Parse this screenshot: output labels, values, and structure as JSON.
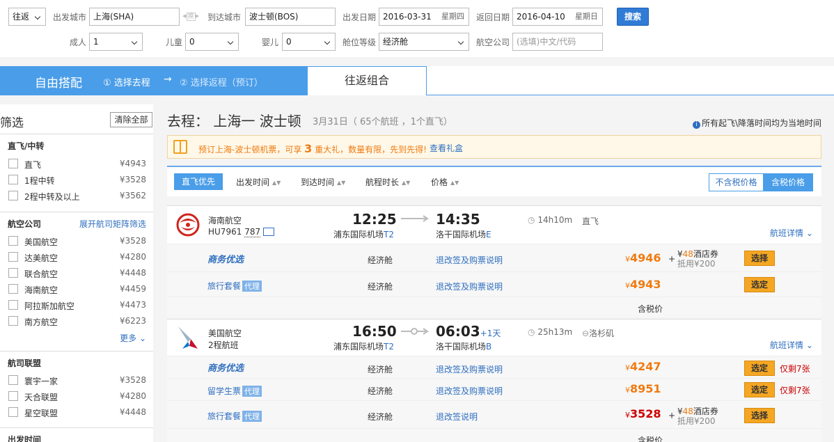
{
  "search": {
    "trip_type": "往返",
    "from_label": "出发城市",
    "from_value": "上海(SHA)",
    "swap_label": "换",
    "to_label": "到达城市",
    "to_value": "波士顿(BOS)",
    "depart_label": "出发日期",
    "depart_value": "2016-03-31",
    "depart_weekday": "星期四",
    "return_label": "返回日期",
    "return_value": "2016-04-10",
    "return_weekday": "星期日",
    "search_button": "搜索",
    "adult_label": "成人",
    "adult_value": "1",
    "child_label": "儿童",
    "child_value": "0",
    "infant_label": "婴儿",
    "infant_value": "0",
    "cabin_label": "舱位等级",
    "cabin_value": "经济舱",
    "airline_label": "航空公司",
    "airline_placeholder": "(选填)中文/代码"
  },
  "tabs": {
    "title": "自由搭配",
    "step1": "① 选择去程",
    "arrow": "→",
    "step2": "② 选择返程（预订）",
    "combo": "往返组合"
  },
  "filters": {
    "title": "筛选",
    "clear_all": "清除全部",
    "groups": {
      "stops": {
        "title": "直飞/中转",
        "items": [
          {
            "name": "直飞",
            "price": "¥4943"
          },
          {
            "name": "1程中转",
            "price": "¥3528"
          },
          {
            "name": "2程中转及以上",
            "price": "¥3562"
          }
        ]
      },
      "airlines": {
        "title": "航空公司",
        "link": "展开航司矩阵筛选",
        "items": [
          {
            "name": "美国航空",
            "price": "¥3528"
          },
          {
            "name": "达美航空",
            "price": "¥4280"
          },
          {
            "name": "联合航空",
            "price": "¥4448"
          },
          {
            "name": "海南航空",
            "price": "¥4459"
          },
          {
            "name": "阿拉斯加航空",
            "price": "¥4473"
          },
          {
            "name": "南方航空",
            "price": "¥6223"
          }
        ],
        "more": "更多"
      },
      "alliances": {
        "title": "航司联盟",
        "items": [
          {
            "name": "寰宇一家",
            "price": "¥3528"
          },
          {
            "name": "天合联盟",
            "price": "¥4280"
          },
          {
            "name": "星空联盟",
            "price": "¥4448"
          }
        ]
      },
      "depart_time": {
        "title": "出发时间"
      }
    }
  },
  "results": {
    "route": "去程： 上海一 波士顿",
    "meta": "3月31日（ 65个航班 ，1个直飞）",
    "note": "所有起飞\\降落时间均为当地时间",
    "promo_text_a": "预订上海-波士顿机票，可享",
    "promo_num": "3",
    "promo_text_b": "重大礼，数量有限，先到先得!",
    "promo_link": "查看礼盒",
    "sort": {
      "direct_first": "直飞优先",
      "depart_time": "出发时间",
      "arrive_time": "到达时间",
      "duration": "航程时长",
      "price": "价格",
      "excl_tax": "不含税价格",
      "incl_tax": "含税价格"
    },
    "tax_label": "含税价",
    "flights": [
      {
        "airline": "海南航空",
        "flight_no": "HU7961",
        "aircraft": "787",
        "dep_time": "12:25",
        "dep_airport": "浦东国际机场",
        "dep_terminal": "T2",
        "arr_time": "14:35",
        "arr_plus": "",
        "arr_airport": "洛干国际机场",
        "arr_terminal": "E",
        "duration": "14h10m",
        "type": "直飞",
        "detail": "航班详情",
        "fares": [
          {
            "product": "商务优选",
            "cabin": "经济舱",
            "rule": "退改签及购票说明",
            "price": "4946",
            "coupon_amt": "48",
            "coupon_txt": "酒店券",
            "coupon_sub": "抵用¥200",
            "button": "选择",
            "left": ""
          },
          {
            "product": "旅行套餐",
            "product_tag": "代理",
            "cabin": "经济舱",
            "rule": "退改签及购票说明",
            "price": "4943",
            "button": "选定",
            "left": ""
          }
        ]
      },
      {
        "airline": "美国航空",
        "flight_no": "2程航班",
        "dep_time": "16:50",
        "dep_airport": "浦东国际机场",
        "dep_terminal": "T2",
        "arr_time": "06:03",
        "arr_plus": "+1天",
        "arr_airport": "洛干国际机场",
        "arr_terminal": "B",
        "duration": "25h13m",
        "type": "洛杉矶",
        "detail": "航班详情",
        "fares": [
          {
            "product": "商务优选",
            "cabin": "经济舱",
            "rule": "退改签及购票说明",
            "price": "4247",
            "button": "选定",
            "left": "仅剩7张"
          },
          {
            "product": "留学生票",
            "product_tag": "代理",
            "cabin": "经济舱",
            "rule": "退改签及购票说明",
            "price": "8951",
            "button": "选定",
            "left": "仅剩7张"
          },
          {
            "product": "旅行套餐",
            "product_tag": "代理",
            "cabin": "经济舱",
            "rule": "退改签说明",
            "price": "3528",
            "coupon_amt": "48",
            "coupon_txt": "酒店券",
            "coupon_sub": "抵用¥200",
            "button": "选择",
            "left": ""
          }
        ]
      }
    ]
  },
  "colors": {
    "brand_blue": "#4a9de8",
    "price_orange": "#f07a10",
    "price_red": "#c00000",
    "book_button": "#f5a623"
  }
}
